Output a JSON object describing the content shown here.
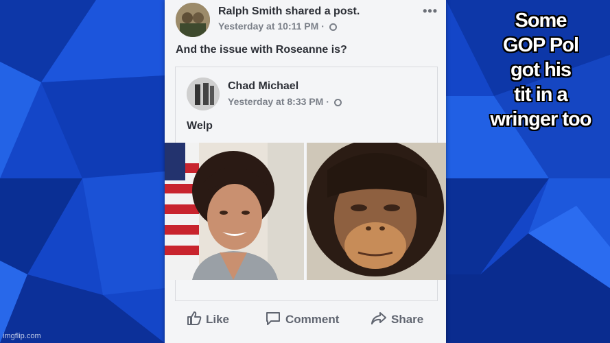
{
  "original_post": {
    "author": "Ralph Smith shared a post.",
    "timestamp": "Yesterday at 10:11 PM",
    "text": "And the issue with Roseanne is?"
  },
  "shared_post": {
    "author": "Chad Michael",
    "timestamp": "Yesterday at 8:33 PM",
    "text": "Welp"
  },
  "actions": {
    "like": "Like",
    "comment": "Comment",
    "share": "Share"
  },
  "caption": {
    "lines": [
      "Some",
      "GOP Pol",
      "got his",
      "tit in a",
      "wringer too"
    ]
  },
  "watermark": "imgflip.com",
  "colors": {
    "background_blue": "#1446c8",
    "card": "#f4f5f7",
    "text_dark": "#2c2f36",
    "meta_gray": "#7a7f88"
  },
  "icons": {
    "menu": "more-dots-icon",
    "privacy": "globe-icon",
    "like": "thumbs-up-icon",
    "comment": "comment-bubble-icon",
    "share": "share-arrow-icon"
  }
}
